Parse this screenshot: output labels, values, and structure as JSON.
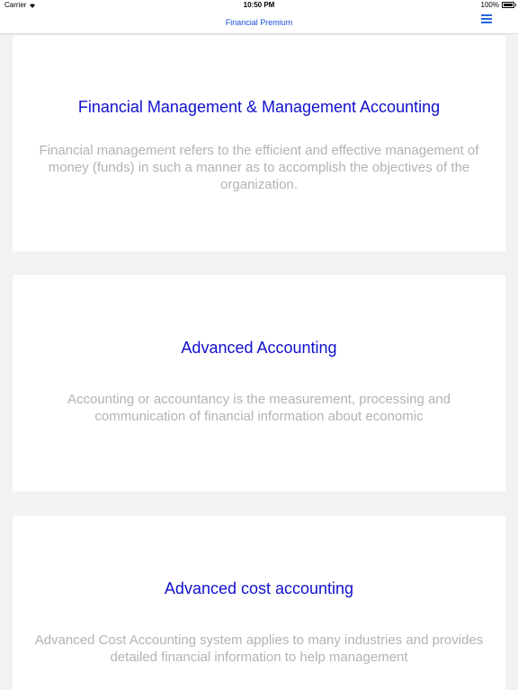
{
  "status_bar": {
    "carrier": "Carrier",
    "time": "10:50 PM",
    "battery": "100%"
  },
  "nav": {
    "title": "Financial Premium",
    "menu_icon": "hamburger-menu-icon"
  },
  "colors": {
    "title": "#1111cc",
    "nav_title": "#1a4fd6",
    "description": "#b3b3b3",
    "background": "#f2f2f2"
  },
  "cards": [
    {
      "title": "Financial Management & Management Accounting",
      "description": "Financial management refers to the efficient and effective management of money (funds) in such a manner as to accomplish the objectives of the organization."
    },
    {
      "title": "Advanced Accounting",
      "description": "Accounting or accountancy is the measurement, processing and communication of financial information about economic"
    },
    {
      "title": "Advanced cost accounting",
      "description": "Advanced Cost Accounting system applies to many industries and provides detailed financial information to help management"
    }
  ]
}
